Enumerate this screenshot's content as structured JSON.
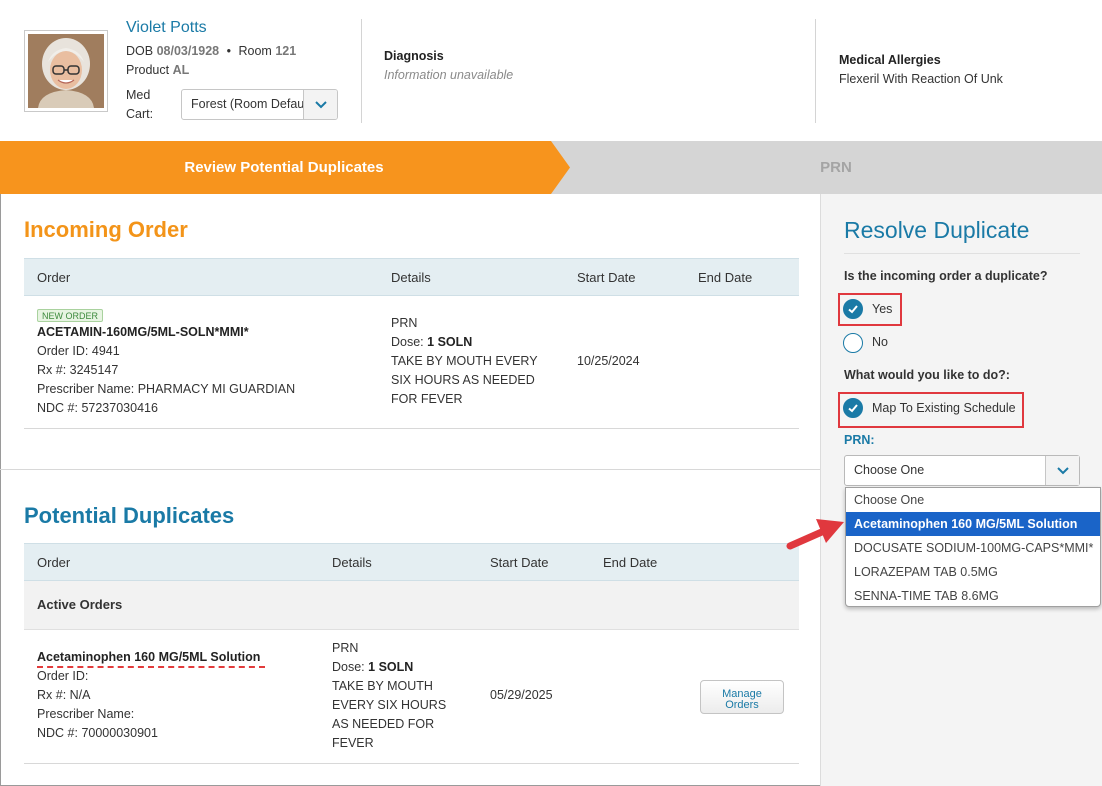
{
  "patient": {
    "name": "Violet Potts",
    "dob_label": "DOB",
    "dob": "08/03/1928",
    "separator": "•",
    "room_label": "Room",
    "room": "121",
    "product_label": "Product",
    "product": "AL",
    "med_cart_label_line1": "Med",
    "med_cart_label_line2": "Cart:",
    "med_cart_value": "Forest (Room Default)"
  },
  "diagnosis": {
    "label": "Diagnosis",
    "value": "Information unavailable"
  },
  "allergies": {
    "label": "Medical Allergies",
    "value": "Flexeril With Reaction Of Unk"
  },
  "steps": [
    {
      "label": "Review Potential Duplicates",
      "active": true
    },
    {
      "label": "PRN",
      "active": false
    }
  ],
  "incoming": {
    "title": "Incoming Order",
    "columns": [
      "Order",
      "Details",
      "Start Date",
      "End Date"
    ],
    "badge": "NEW ORDER",
    "drug": "ACETAMIN-160MG/5ML-SOLN*MMI*",
    "order_id": "Order ID: 4941",
    "rx": "Rx #: 3245147",
    "prescriber": "Prescriber Name: PHARMACY MI GUARDIAN",
    "ndc": "NDC #: 57237030416",
    "details_prn": "PRN",
    "details_dose_label": "Dose: ",
    "details_dose_value": "1 SOLN",
    "details_instructions": [
      "TAKE BY MOUTH EVERY",
      "SIX HOURS AS NEEDED",
      "FOR FEVER"
    ],
    "start_date": "10/25/2024",
    "end_date": ""
  },
  "duplicates": {
    "title": "Potential Duplicates",
    "columns": [
      "Order",
      "Details",
      "Start Date",
      "End Date"
    ],
    "group_label": "Active Orders",
    "drug": "Acetaminophen 160 MG/5ML Solution",
    "order_id": "Order ID:",
    "rx": "Rx #: N/A",
    "prescriber": "Prescriber Name:",
    "ndc": "NDC #: 70000030901",
    "details_prn": "PRN",
    "details_dose_label": "Dose: ",
    "details_dose_value": "1 SOLN",
    "details_instructions": [
      "TAKE BY MOUTH",
      "EVERY SIX HOURS",
      "AS NEEDED FOR",
      "FEVER"
    ],
    "start_date": "05/29/2025",
    "manage_button_line1": "Manage",
    "manage_button_line2": "Orders"
  },
  "resolve": {
    "title": "Resolve Duplicate",
    "question1": "Is the incoming order a duplicate?",
    "options1": [
      {
        "label": "Yes",
        "checked": true
      },
      {
        "label": "No",
        "checked": false
      }
    ],
    "question2": "What would you like to do?:",
    "action_option": {
      "label": "Map To Existing Schedule",
      "checked": true
    },
    "prn_label": "PRN:",
    "prn_select_value": "Choose One",
    "prn_options": [
      "Choose One",
      "Acetaminophen 160 MG/5ML Solution",
      "DOCUSATE SODIUM-100MG-CAPS*MMI*",
      "LORAZEPAM TAB 0.5MG",
      "SENNA-TIME TAB 8.6MG"
    ],
    "prn_highlighted_index": 1
  },
  "colors": {
    "accent_blue": "#1a7aa6",
    "step_orange": "#f7941d",
    "highlight_red": "#e0383e",
    "selected_option": "#1a64c8"
  }
}
